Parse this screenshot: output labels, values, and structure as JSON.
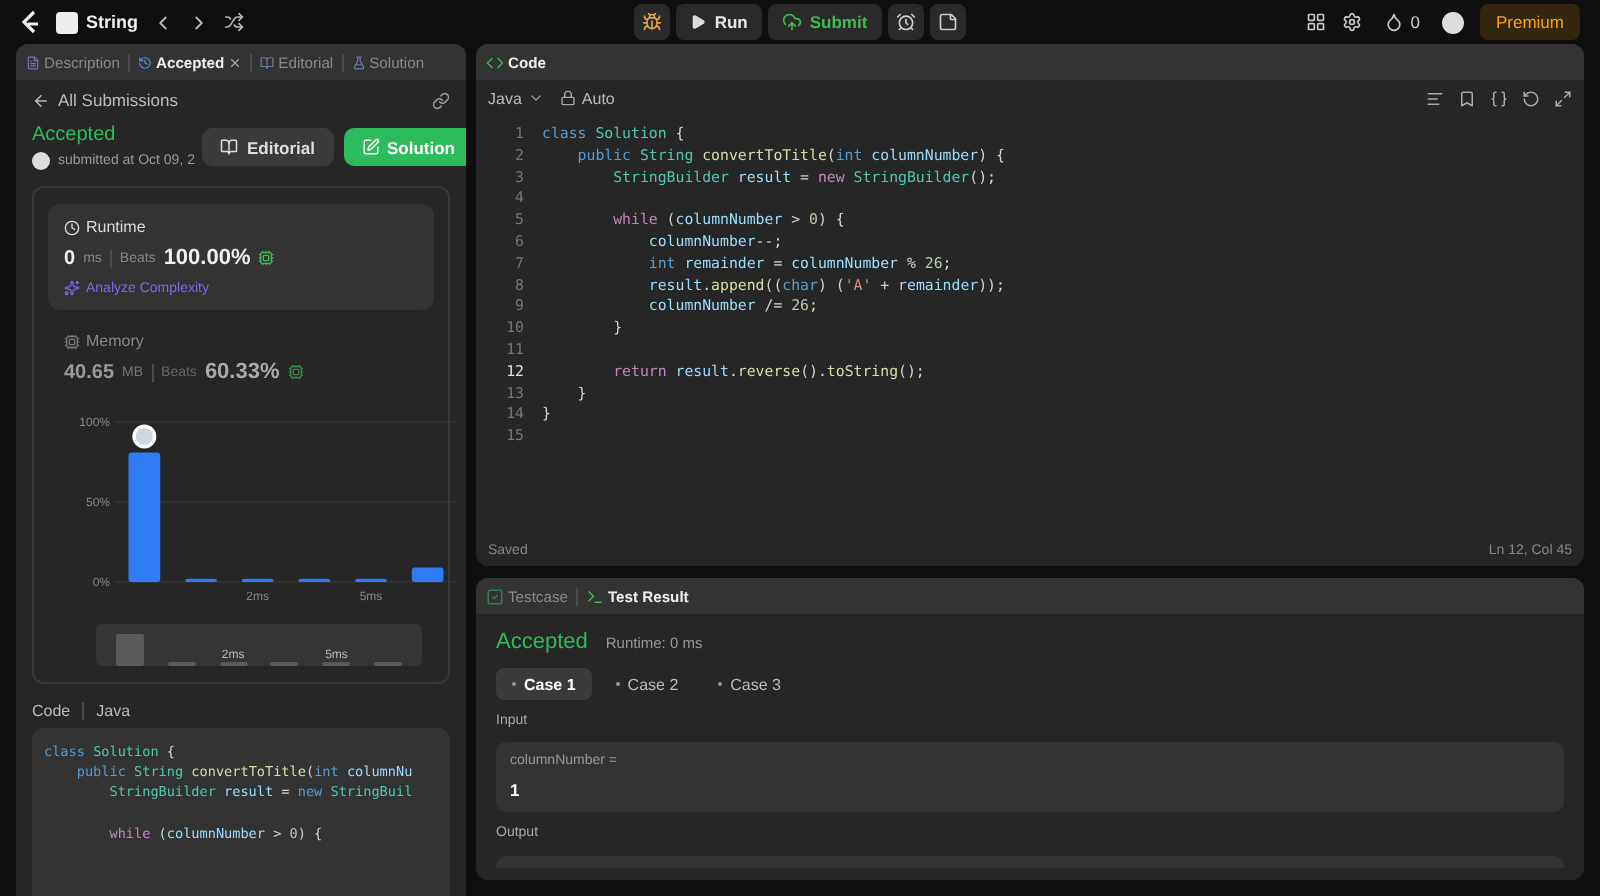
{
  "topbar": {
    "problem": "String",
    "run": "Run",
    "submit": "Submit",
    "streak": "0",
    "premium": "Premium"
  },
  "left_tabs": [
    {
      "label": "Description",
      "selected": false,
      "closable": false
    },
    {
      "label": "Accepted",
      "selected": true,
      "closable": true
    },
    {
      "label": "Editorial",
      "selected": false,
      "closable": false
    },
    {
      "label": "Solution",
      "selected": false,
      "closable": false
    }
  ],
  "submission": {
    "back": "All Submissions",
    "status": "Accepted",
    "submitted": "submitted at Oct 09, 2",
    "buttons": [
      {
        "label": "Editorial",
        "kind": "secondary"
      },
      {
        "label": "Solution",
        "kind": "primary"
      }
    ]
  },
  "runtime": {
    "title": "Runtime",
    "value": "0",
    "unit": "ms",
    "beats_label": "Beats",
    "beats": "100.00%",
    "analyze": "Analyze Complexity",
    "selected": true
  },
  "memory": {
    "title": "Memory",
    "value": "40.65",
    "unit": "MB",
    "beats_label": "Beats",
    "beats": "60.33%",
    "selected": false
  },
  "chart_data": {
    "type": "bar",
    "x": [
      -1,
      0.5,
      2,
      3.5,
      5,
      6.5
    ],
    "values": [
      81,
      2,
      2,
      2,
      2,
      9
    ],
    "xlim": [
      -1.75,
      7.25
    ],
    "ylim": [
      0,
      100
    ],
    "yticks": [
      {
        "value": 0,
        "label": "0%"
      },
      {
        "value": 50,
        "label": "50%"
      },
      {
        "value": 100,
        "label": "100%"
      }
    ],
    "xticks": [
      {
        "value": 2,
        "label": "2ms"
      },
      {
        "value": 5,
        "label": "5ms"
      }
    ]
  },
  "navigator_ticks": [
    "2ms",
    "5ms"
  ],
  "code_preview": {
    "tabs": [
      "Code",
      "Java"
    ],
    "lines": [
      {
        "gap_before": false,
        "tokens": [
          {
            "text": "class ",
            "kind": "keyword"
          },
          {
            "text": "Solution",
            "kind": "type"
          },
          {
            "text": " {",
            "kind": "plain"
          }
        ]
      },
      {
        "gap_before": false,
        "tokens": [
          {
            "text": "    public ",
            "kind": "keyword"
          },
          {
            "text": "String ",
            "kind": "type"
          },
          {
            "text": "convertToTitle",
            "kind": "function"
          },
          {
            "text": "(",
            "kind": "plain"
          },
          {
            "text": "int ",
            "kind": "keyword"
          },
          {
            "text": "columnNu",
            "kind": "variable"
          }
        ]
      },
      {
        "gap_before": false,
        "tokens": [
          {
            "text": "        StringBuilder ",
            "kind": "type"
          },
          {
            "text": "result",
            "kind": "variable"
          },
          {
            "text": " = ",
            "kind": "plain"
          },
          {
            "text": "new ",
            "kind": "keyword"
          },
          {
            "text": "StringBuil",
            "kind": "type"
          }
        ]
      },
      {
        "gap_before": true,
        "tokens": [
          {
            "text": "        while",
            "kind": "control"
          },
          {
            "text": " (",
            "kind": "plain"
          },
          {
            "text": "columnNumber",
            "kind": "variable"
          },
          {
            "text": " > ",
            "kind": "plain"
          },
          {
            "text": "0",
            "kind": "number"
          },
          {
            "text": ") {",
            "kind": "plain"
          }
        ]
      }
    ]
  },
  "editor": {
    "title": "Code",
    "language": "Java",
    "mode": "Auto",
    "status": "Saved",
    "position": "Ln 12, Col 45",
    "lines": [
      {
        "n": "1",
        "current": false,
        "tokens": [
          {
            "text": "class ",
            "kind": "keyword"
          },
          {
            "text": "Solution",
            "kind": "type"
          },
          {
            "text": " {",
            "kind": "plain"
          }
        ]
      },
      {
        "n": "2",
        "current": false,
        "tokens": [
          {
            "text": "    public ",
            "kind": "keyword"
          },
          {
            "text": "String ",
            "kind": "type"
          },
          {
            "text": "convertToTitle",
            "kind": "function"
          },
          {
            "text": "(",
            "kind": "plain"
          },
          {
            "text": "int ",
            "kind": "keyword"
          },
          {
            "text": "columnNumber",
            "kind": "variable"
          },
          {
            "text": ") {",
            "kind": "plain"
          }
        ]
      },
      {
        "n": "3",
        "current": false,
        "tokens": [
          {
            "text": "        StringBuilder ",
            "kind": "type"
          },
          {
            "text": "result",
            "kind": "variable"
          },
          {
            "text": " = ",
            "kind": "plain"
          },
          {
            "text": "new ",
            "kind": "control"
          },
          {
            "text": "StringBuilder",
            "kind": "type"
          },
          {
            "text": "();",
            "kind": "plain"
          }
        ]
      },
      {
        "n": "4",
        "current": false
      },
      {
        "n": "5",
        "current": false,
        "tokens": [
          {
            "text": "        while",
            "kind": "control"
          },
          {
            "text": " (",
            "kind": "plain"
          },
          {
            "text": "columnNumber",
            "kind": "variable"
          },
          {
            "text": " > ",
            "kind": "plain"
          },
          {
            "text": "0",
            "kind": "number"
          },
          {
            "text": ") {",
            "kind": "plain"
          }
        ]
      },
      {
        "n": "6",
        "current": false,
        "tokens": [
          {
            "text": "            columnNumber",
            "kind": "variable"
          },
          {
            "text": "--;",
            "kind": "plain"
          }
        ]
      },
      {
        "n": "7",
        "current": false,
        "tokens": [
          {
            "text": "            int ",
            "kind": "keyword"
          },
          {
            "text": "remainder",
            "kind": "variable"
          },
          {
            "text": " = ",
            "kind": "plain"
          },
          {
            "text": "columnNumber",
            "kind": "variable"
          },
          {
            "text": " % ",
            "kind": "plain"
          },
          {
            "text": "26",
            "kind": "number"
          },
          {
            "text": ";",
            "kind": "plain"
          }
        ]
      },
      {
        "n": "8",
        "current": false,
        "tokens": [
          {
            "text": "            result",
            "kind": "variable"
          },
          {
            "text": ".",
            "kind": "plain"
          },
          {
            "text": "append",
            "kind": "function"
          },
          {
            "text": "((",
            "kind": "plain"
          },
          {
            "text": "char",
            "kind": "keyword"
          },
          {
            "text": ") (",
            "kind": "plain"
          },
          {
            "text": "'A'",
            "kind": "string"
          },
          {
            "text": " + ",
            "kind": "plain"
          },
          {
            "text": "remainder",
            "kind": "variable"
          },
          {
            "text": "));",
            "kind": "plain"
          }
        ]
      },
      {
        "n": "9",
        "current": false,
        "tokens": [
          {
            "text": "            columnNumber",
            "kind": "variable"
          },
          {
            "text": " /= ",
            "kind": "plain"
          },
          {
            "text": "26",
            "kind": "number"
          },
          {
            "text": ";",
            "kind": "plain"
          }
        ]
      },
      {
        "n": "10",
        "current": false,
        "tokens": [
          {
            "text": "        }",
            "kind": "plain"
          }
        ]
      },
      {
        "n": "11",
        "current": false
      },
      {
        "n": "12",
        "current": true,
        "tokens": [
          {
            "text": "        return ",
            "kind": "control"
          },
          {
            "text": "result",
            "kind": "variable"
          },
          {
            "text": ".",
            "kind": "plain"
          },
          {
            "text": "reverse",
            "kind": "function"
          },
          {
            "text": "().",
            "kind": "plain"
          },
          {
            "text": "toString",
            "kind": "function"
          },
          {
            "text": "();",
            "kind": "plain"
          }
        ]
      },
      {
        "n": "13",
        "current": false,
        "tokens": [
          {
            "text": "    }",
            "kind": "plain"
          }
        ]
      },
      {
        "n": "14",
        "current": false,
        "tokens": [
          {
            "text": "}",
            "kind": "plain"
          }
        ]
      },
      {
        "n": "15",
        "current": false
      }
    ]
  },
  "results": {
    "tabs": [
      {
        "label": "Testcase",
        "selected": false
      },
      {
        "label": "Test Result",
        "selected": true
      }
    ],
    "status": "Accepted",
    "runtime": "Runtime: 0 ms",
    "cases": [
      {
        "label": "Case 1",
        "selected": true
      },
      {
        "label": "Case 2",
        "selected": false
      },
      {
        "label": "Case 3",
        "selected": false
      }
    ],
    "input_label": "Input",
    "inputs": [
      {
        "name": "columnNumber =",
        "value": "1"
      }
    ],
    "output_label": "Output"
  }
}
